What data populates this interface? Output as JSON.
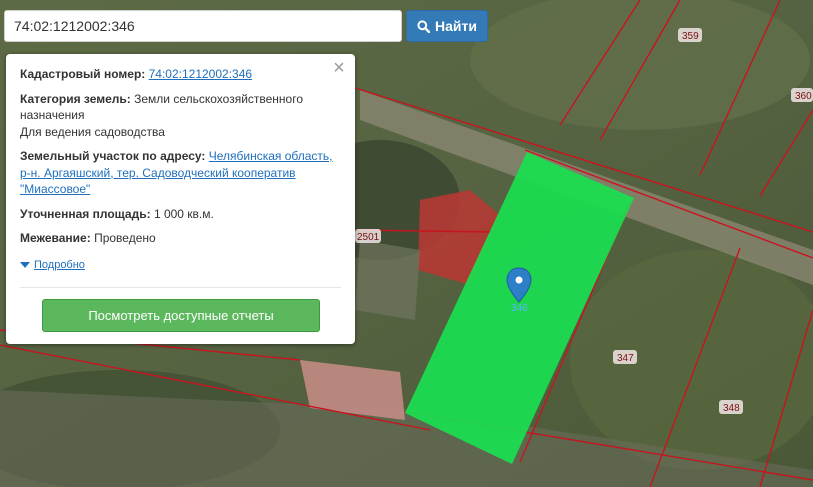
{
  "search": {
    "value": "74:02:1212002:346",
    "button_label": "Найти",
    "button_icon": "search-icon"
  },
  "map": {
    "parcel_labels": [
      "359",
      "360",
      "2501",
      "347",
      "348"
    ],
    "marker_label": "346",
    "highlight_color": "#19e04f",
    "boundary_color": "#c8141e"
  },
  "popup": {
    "cadastral_label": "Кадастровый номер:",
    "cadastral_value": "74:02:1212002:346",
    "category_label": "Категория земель:",
    "category_value": "Земли сельскохозяйственного назначения",
    "category_use": "Для ведения садоводства",
    "address_label": "Земельный участок по адресу:",
    "address_value": "Челябинская область, р-н. Аргаяшский, тер. Садоводческий кооператив \"Миассовое\"",
    "area_label": "Уточненная площадь:",
    "area_value": "1 000 кв.м.",
    "survey_label": "Межевание:",
    "survey_value": "Проведено",
    "more_label": "Подробно",
    "report_button": "Посмотреть доступные отчеты",
    "close_icon": "close-icon"
  }
}
